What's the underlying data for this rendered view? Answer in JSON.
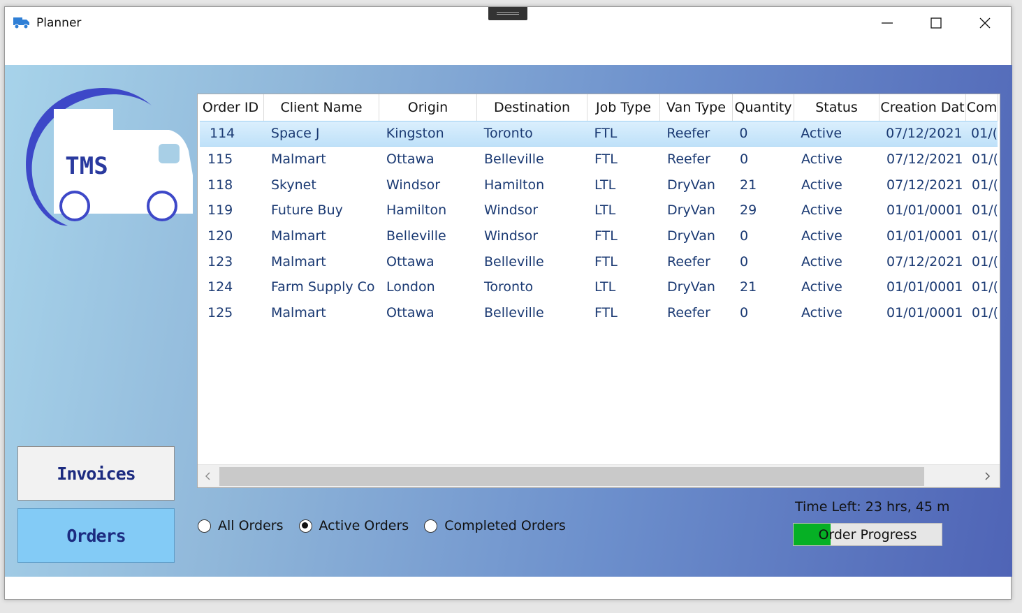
{
  "window": {
    "title": "Planner",
    "icon": "truck-app-icon"
  },
  "logo": {
    "text": "TMS"
  },
  "nav": {
    "invoices_label": "Invoices",
    "orders_label": "Orders"
  },
  "table": {
    "columns": [
      "Order ID",
      "Client Name",
      "Origin",
      "Destination",
      "Job Type",
      "Van Type",
      "Quantity",
      "Status",
      "Creation Dat",
      "Com"
    ],
    "rows": [
      [
        "114",
        "Space J",
        "Kingston",
        "Toronto",
        "FTL",
        "Reefer",
        "0",
        "Active",
        "07/12/2021",
        "01/("
      ],
      [
        "115",
        "Malmart",
        "Ottawa",
        "Belleville",
        "FTL",
        "Reefer",
        "0",
        "Active",
        "07/12/2021",
        "01/("
      ],
      [
        "118",
        "Skynet",
        "Windsor",
        "Hamilton",
        "LTL",
        "DryVan",
        "21",
        "Active",
        "07/12/2021",
        "01/("
      ],
      [
        "119",
        "Future Buy",
        "Hamilton",
        "Windsor",
        "LTL",
        "DryVan",
        "29",
        "Active",
        "01/01/0001",
        "01/("
      ],
      [
        "120",
        "Malmart",
        "Belleville",
        "Windsor",
        "FTL",
        "DryVan",
        "0",
        "Active",
        "01/01/0001",
        "01/("
      ],
      [
        "123",
        "Malmart",
        "Ottawa",
        "Belleville",
        "FTL",
        "Reefer",
        "0",
        "Active",
        "07/12/2021",
        "01/("
      ],
      [
        "124",
        "Farm Supply Co",
        "London",
        "Toronto",
        "LTL",
        "DryVan",
        "21",
        "Active",
        "01/01/0001",
        "01/("
      ],
      [
        "125",
        "Malmart",
        "Ottawa",
        "Belleville",
        "FTL",
        "Reefer",
        "0",
        "Active",
        "01/01/0001",
        "01/("
      ]
    ],
    "selected_row": 0
  },
  "filters": {
    "all_label": "All Orders",
    "active_label": "Active Orders",
    "completed_label": "Completed Orders",
    "selected": "active"
  },
  "status": {
    "time_left": "Time Left: 23 hrs, 45 m",
    "progress_label": "Order Progress",
    "progress_fraction": 0.25
  },
  "colors": {
    "accent": "#1c2b80",
    "orders_active": "#83cbf6",
    "progress_fill": "#06b025",
    "logo_blue": "#3d48c8"
  }
}
